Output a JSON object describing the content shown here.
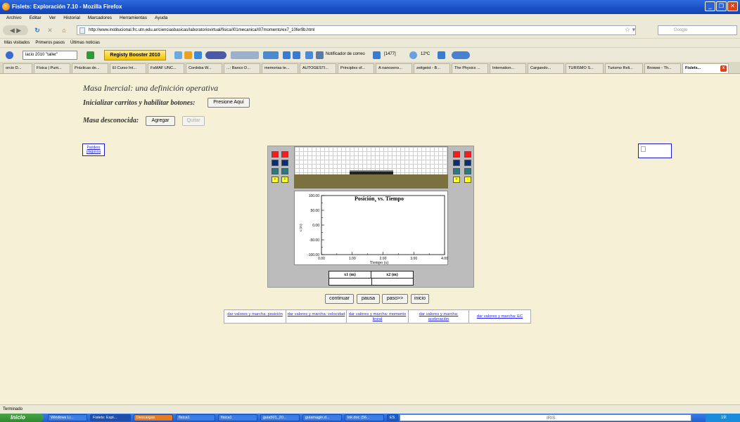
{
  "window": {
    "title": "Fislets: Exploración 7.10 - Mozilla Firefox"
  },
  "menu": [
    "Archivo",
    "Editar",
    "Ver",
    "Historial",
    "Marcadores",
    "Herramientas",
    "Ayuda"
  ],
  "nav": {
    "url": "http://www.institucional.frc.utn.edu.ar/cienciasbasicas/laboratoriovirtual/fisica/I01mecanica/I07momento/ex7_10fer9b.html",
    "search_placeholder": "Google"
  },
  "bookmarks": [
    "Más visitados",
    "Primeros pasos",
    "Últimas noticias"
  ],
  "toolbar2": {
    "search_value": "lacio 2010 \"taller\"",
    "booster": "Registy Booster 2010",
    "mail_notifier": "Notificador de correo",
    "count": "[1477]",
    "weather": "12ºC"
  },
  "tabs": [
    "orcio D...",
    "Física | Punt...",
    "Prácticas de...",
    "El Curso Int...",
    "FaMAF UNC...",
    "Cordoba W...",
    "...: Banco D...",
    "memorias te...",
    "AUTOGESTI...",
    "Principles of...",
    "A nanosens...",
    "zeitgeist - B...",
    "The Physics ...",
    "Internation...",
    "Cargando...",
    "TURISMO S...",
    "Turismo Reli...",
    "Browse - Th...",
    "Fislets..."
  ],
  "page": {
    "title": "Masa Inercial: una definición operativa",
    "init_label": "Inicializar carritos y habilitar botones:",
    "init_button": "Presione Aquí",
    "mass_label": "Masa desconocida:",
    "add_button": "Agregar",
    "remove_button": "Quitar",
    "left_plugin": "Paridero plagasoa",
    "sim_buttons": {
      "plus": "+",
      "minus": "-"
    },
    "table_headers": [
      "x1 (m)",
      "x2 (m)"
    ],
    "controls": [
      "continuar",
      "pausa",
      "paso>>",
      "inicio"
    ],
    "links": [
      "dar valores y marcha: posición",
      "dar valores y marcha: velocidad",
      "dar valores y marcha: momento lineal",
      "dar valores y marcha: aceleración",
      "dar valores y marcha: EC"
    ]
  },
  "chart_data": {
    "type": "line",
    "title": "Posición",
    "title_subscript": "x",
    "title_suffix": " vs. Tiempo",
    "xlabel": "Tiempo (s)",
    "ylabel": "x (m)",
    "xlim": [
      0,
      4
    ],
    "ylim": [
      -100,
      100
    ],
    "x_ticks": [
      "0.00",
      "1.00",
      "2.00",
      "3.00",
      "4.00"
    ],
    "y_ticks": [
      "100.00",
      "50.00",
      "0.00",
      "-50.00",
      "-100.00"
    ],
    "series": []
  },
  "status": "Terminado",
  "taskbar": {
    "start": "Inicio",
    "tasks": [
      "Windows Li...",
      "Fislets: Expl...",
      "Descargas",
      "fisica1",
      "fisica1",
      "guia501_20...",
      "guiamagin.d...",
      "lnk.doc (56...",
      "ES"
    ],
    "search_brand": "IRIS",
    "clock": "19:"
  }
}
